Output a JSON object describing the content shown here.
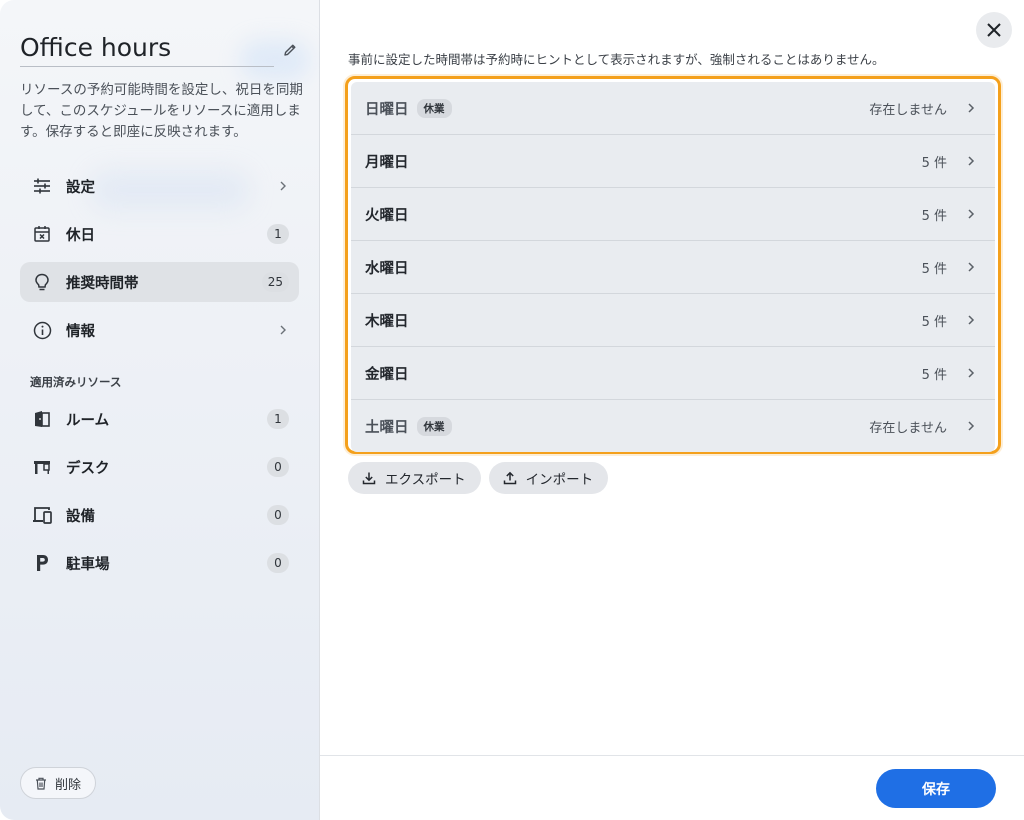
{
  "sidebar": {
    "title": "Office hours",
    "description": "リソースの予約可能時間を設定し、祝日を同期して、このスケジュールをリソースに適用します。保存すると即座に反映されます。",
    "nav": [
      {
        "label": "設定",
        "icon": "sliders-icon",
        "badge": null
      },
      {
        "label": "休日",
        "icon": "calendar-x-icon",
        "badge": "1"
      },
      {
        "label": "推奨時間帯",
        "icon": "lightbulb-icon",
        "badge": "25",
        "active": true
      },
      {
        "label": "情報",
        "icon": "info-icon",
        "badge": null
      }
    ],
    "resources_label": "適用済みリソース",
    "resources": [
      {
        "label": "ルーム",
        "icon": "door-icon",
        "badge": "1"
      },
      {
        "label": "デスク",
        "icon": "desk-icon",
        "badge": "0"
      },
      {
        "label": "設備",
        "icon": "devices-icon",
        "badge": "0"
      },
      {
        "label": "駐車場",
        "icon": "parking-icon",
        "badge": "0"
      }
    ],
    "delete_label": "削除"
  },
  "main": {
    "hint": "事前に設定した時間帯は予約時にヒントとして表示されますが、強制されることはありません。",
    "days": [
      {
        "name": "日曜日",
        "tag": "休業",
        "status": "存在しません"
      },
      {
        "name": "月曜日",
        "tag": null,
        "status": "5 件"
      },
      {
        "name": "火曜日",
        "tag": null,
        "status": "5 件"
      },
      {
        "name": "水曜日",
        "tag": null,
        "status": "5 件"
      },
      {
        "name": "木曜日",
        "tag": null,
        "status": "5 件"
      },
      {
        "name": "金曜日",
        "tag": null,
        "status": "5 件"
      },
      {
        "name": "土曜日",
        "tag": "休業",
        "status": "存在しません"
      }
    ],
    "export_label": "エクスポート",
    "import_label": "インポート",
    "save_label": "保存"
  },
  "colors": {
    "accent": "#1f6fe5",
    "highlight_border": "#f4a01c"
  }
}
